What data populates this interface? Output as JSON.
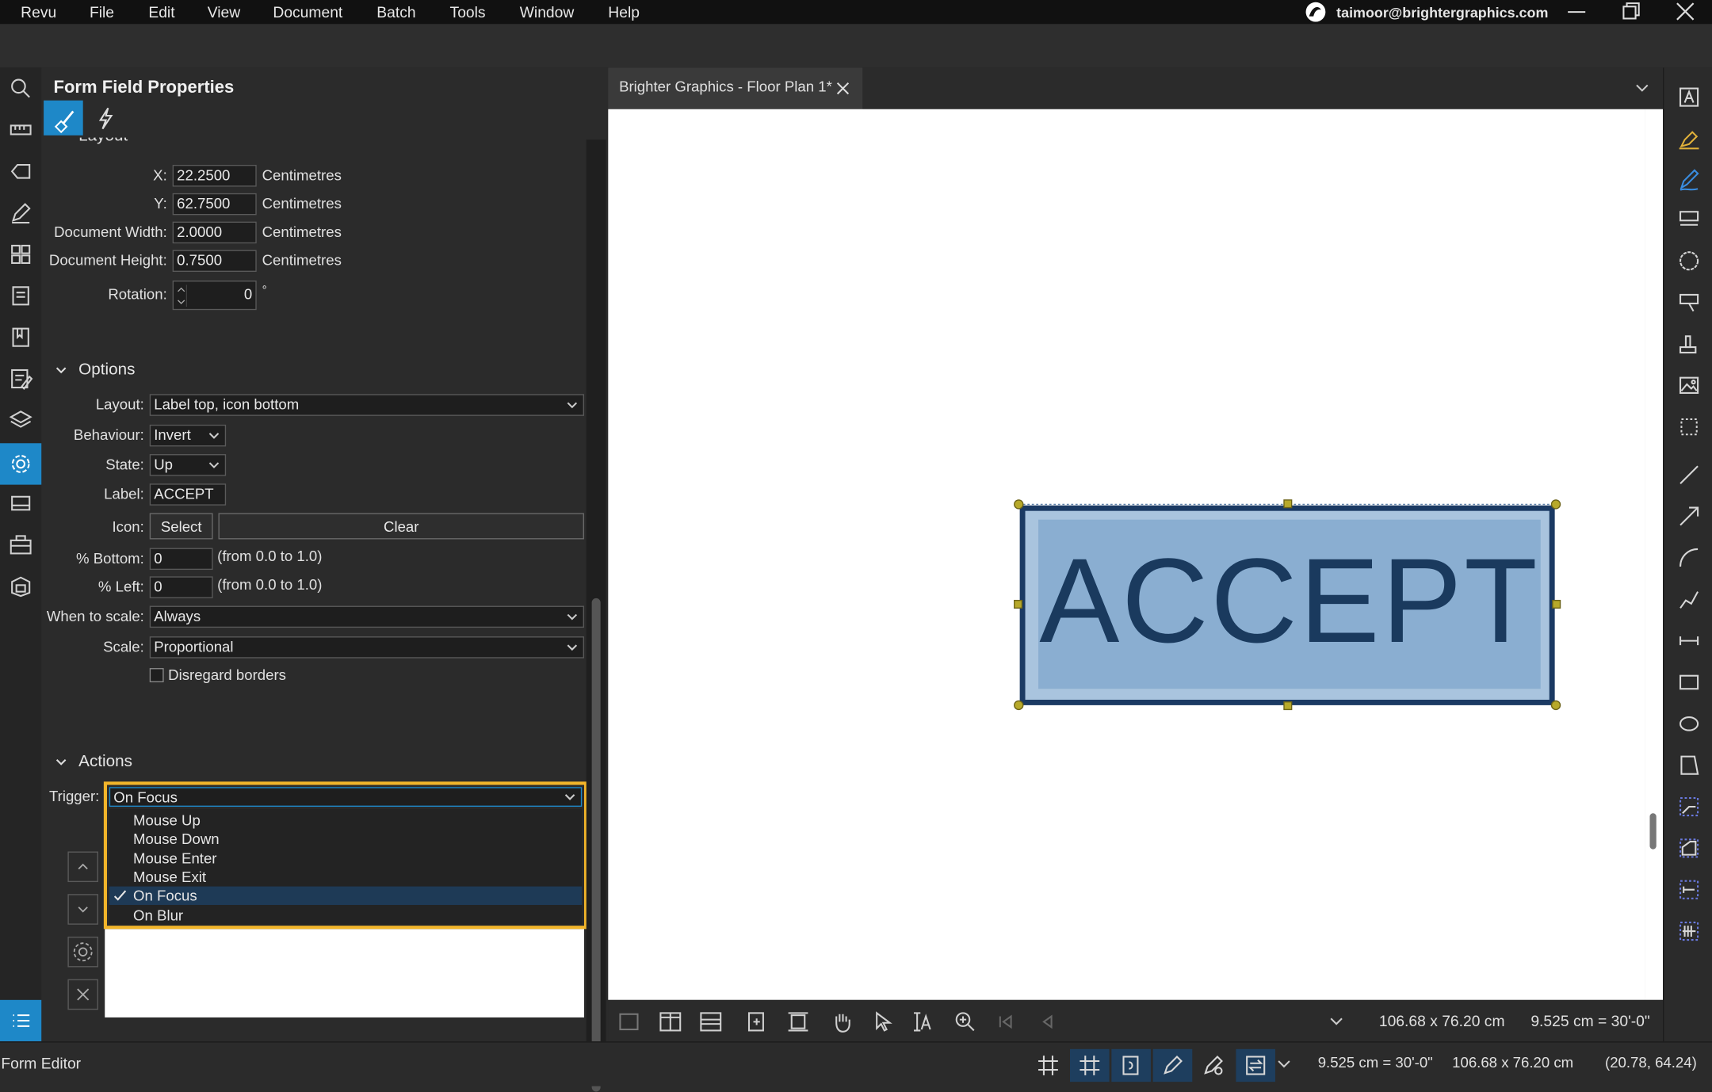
{
  "menubar": {
    "items": [
      "Revu",
      "File",
      "Edit",
      "View",
      "Document",
      "Batch",
      "Tools",
      "Window",
      "Help"
    ],
    "account": "taimoor@brightergraphics.com"
  },
  "panel": {
    "title": "Form Field Properties",
    "layout_section": {
      "header": "Layout",
      "x_label": "X:",
      "x_value": "22.2500",
      "y_label": "Y:",
      "y_value": "62.7500",
      "width_label": "Document Width:",
      "width_value": "2.0000",
      "height_label": "Document Height:",
      "height_value": "0.7500",
      "unit": "Centimetres",
      "rotation_label": "Rotation:",
      "rotation_value": "0",
      "rotation_unit": "°"
    },
    "options_section": {
      "header": "Options",
      "layout_label": "Layout:",
      "layout_value": "Label top, icon bottom",
      "behaviour_label": "Behaviour:",
      "behaviour_value": "Invert",
      "state_label": "State:",
      "state_value": "Up",
      "label_label": "Label:",
      "label_value": "ACCEPT",
      "icon_label": "Icon:",
      "select_btn": "Select",
      "clear_btn": "Clear",
      "bottom_label": "% Bottom:",
      "bottom_value": "0",
      "bottom_hint": "(from 0.0 to 1.0)",
      "left_label": "% Left:",
      "left_value": "0",
      "left_hint": "(from 0.0 to 1.0)",
      "when_label": "When to scale:",
      "when_value": "Always",
      "scale_label": "Scale:",
      "scale_value": "Proportional",
      "disregard_label": "Disregard borders"
    },
    "actions_section": {
      "header": "Actions",
      "trigger_label": "Trigger:",
      "trigger_value": "On Focus",
      "options": [
        "Mouse Up",
        "Mouse Down",
        "Mouse Enter",
        "Mouse Exit",
        "On Focus",
        "On Blur"
      ],
      "selected": "On Focus"
    }
  },
  "document": {
    "tab_title": "Brighter Graphics - Floor Plan 1*",
    "button_text": "ACCEPT",
    "page_size": "106.68 x 76.20 cm",
    "scale": "9.525 cm = 30'-0\""
  },
  "status": {
    "mode": "Form Editor",
    "scale": "9.525 cm = 30'-0\"",
    "page_size": "106.68 x 76.20 cm",
    "cursor": "(20.78, 64.24)"
  },
  "colors": {
    "accent": "#1e88c8",
    "highlight_border": "#f2b52a",
    "button_fill": "#8aaed1",
    "button_border": "#1b3a63",
    "button_text": "#1a3a5e",
    "handle": "#b7a92a"
  }
}
